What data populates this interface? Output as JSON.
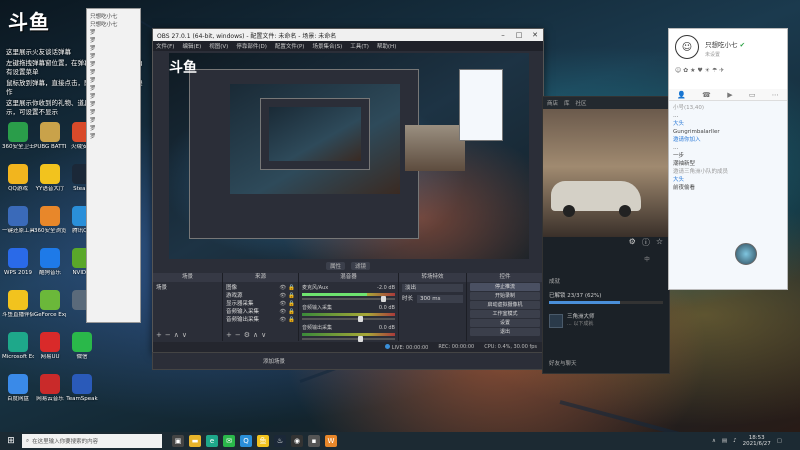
{
  "colors": {
    "accent": "#3a8fd9",
    "obs_bg": "#2b2e38",
    "taskbar": "#1c2a33",
    "qq_verified": "#2ba245"
  },
  "overlay": {
    "logo_text": "斗鱼",
    "chat": [
      {
        "text": "这里展示火友谈话弹幕"
      },
      {
        "text": "左键拖拽弹幕窗位置，在弹幕区域内鼠标右上角有设置菜单"
      },
      {
        "text": "鼠标放到弹幕，直接点击，即可进行弹幕收缩操作"
      },
      {
        "text": "这里展示你收到的礼物、道具、贵族开通的提示，可设置不显示"
      }
    ]
  },
  "desktop_icons": [
    {
      "label": "360安全卫士",
      "icon": "shield-icon",
      "color": "#2a9d4a"
    },
    {
      "label": "PUBG BATTLEGR...",
      "icon": "pubg-icon",
      "color": "#c9a24a"
    },
    {
      "label": "火绒安全",
      "icon": "fire-icon",
      "color": "#d94a2a"
    },
    {
      "label": "QQ游戏",
      "icon": "qq-game-icon",
      "color": "#f2b51e"
    },
    {
      "label": "YY语音大厅",
      "icon": "yy-icon",
      "color": "#f2c31e"
    },
    {
      "label": "Steam",
      "icon": "steam-icon",
      "color": "#1b2838"
    },
    {
      "label": "一键还原工具",
      "icon": "restore-icon",
      "color": "#3a6ab9"
    },
    {
      "label": "360安全浏览器",
      "icon": "browser-icon",
      "color": "#e8872a"
    },
    {
      "label": "腾讯QQ",
      "icon": "qq-icon",
      "color": "#2a8fd9"
    },
    {
      "label": "WPS 2019",
      "icon": "wps-icon",
      "color": "#2a6ae8"
    },
    {
      "label": "酷狗音乐",
      "icon": "kugou-icon",
      "color": "#1e7ae8"
    },
    {
      "label": "NVIDIA",
      "icon": "nvidia-icon",
      "color": "#5aa82a"
    },
    {
      "label": "斗鱼直播伴侣",
      "icon": "douyu-icon",
      "color": "#f2c31e"
    },
    {
      "label": "GeForce Experience",
      "icon": "geforce-icon",
      "color": "#6bb83a"
    },
    {
      "label": "",
      "icon": "app-icon",
      "color": "#5a6a7a"
    },
    {
      "label": "Microsoft Edge",
      "icon": "edge-icon",
      "color": "#1ea88a"
    },
    {
      "label": "网易UU",
      "icon": "uu-icon",
      "color": "#d92a2a"
    },
    {
      "label": "微信",
      "icon": "wechat-icon",
      "color": "#2ab84a"
    },
    {
      "label": "百度网盘",
      "icon": "baidu-icon",
      "color": "#3a8ae8"
    },
    {
      "label": "网易云音乐",
      "icon": "music-icon",
      "color": "#c92a2a"
    },
    {
      "label": "TeamSpeak",
      "icon": "teamspeak-icon",
      "color": "#2a5ab9"
    }
  ],
  "left_chat": {
    "lines": [
      "只想吃小七",
      "只想吃小七",
      "罗",
      "罗",
      "罗",
      "罗",
      "罗",
      "罗",
      "罗",
      "罗",
      "罗",
      "罗",
      "罗",
      "罗",
      "罗",
      "罗"
    ]
  },
  "obs": {
    "title": "OBS 27.0.1 (64-bit, windows) - 配置文件: 未命名 - 场景: 未命名",
    "menu": [
      "文件(F)",
      "编辑(E)",
      "视图(V)",
      "停靠部件(D)",
      "配置文件(P)",
      "场景集合(S)",
      "工具(T)",
      "帮助(H)"
    ],
    "toolbar": [
      "属性",
      "滤镜"
    ],
    "docks": {
      "scenes": {
        "header": "场景",
        "items": [
          "场景"
        ]
      },
      "sources": {
        "header": "来源",
        "items": [
          "图像",
          "游戏源",
          "显示器采集",
          "音频输入采集",
          "音频输出采集"
        ]
      },
      "mixer": {
        "header": "混音器",
        "rows": [
          {
            "name": "麦克风/Aux",
            "db": "-2.0 dB",
            "level": 0.7,
            "volume": 0.85
          },
          {
            "name": "音频输入采集",
            "db": "0.0 dB",
            "level": 0.0,
            "volume": 0.6
          },
          {
            "name": "音频输出采集",
            "db": "0.0 dB",
            "level": 0.0,
            "volume": 0.6
          }
        ]
      },
      "transitions": {
        "header": "转场特效",
        "label": "淡出",
        "duration_label": "时长",
        "duration": "300 ms"
      },
      "controls": {
        "header": "控件",
        "buttons": [
          "停止推流",
          "开始录制",
          "启动虚拟摄像机",
          "工作室模式",
          "设置",
          "退出"
        ]
      }
    },
    "status": {
      "live": "LIVE: 00:00:00",
      "rec": "REC: 00:00:00",
      "cpu": "CPU: 0.4%, 30.00 fps"
    },
    "below_label": "添加场景"
  },
  "launcher": {
    "top": [
      "商店",
      "库",
      "社区"
    ],
    "tabs": [
      "",
      "",
      "中"
    ],
    "ach_header": "成就",
    "ach_progress_text": "已解锁 23/37 (62%)",
    "ach_progress": 0.62,
    "ach_item_title": "三角洲大师",
    "ach_item_sub": "... 以下成就",
    "bottom": [
      "好友与聊天",
      ""
    ]
  },
  "qq": {
    "name": "只想吃小七",
    "signature": "未设置",
    "toolbar": [
      "person-icon",
      "phone-icon",
      "video-icon",
      "screen-icon",
      "more-icon"
    ],
    "messages": [
      {
        "text": "小号(13,40)",
        "cls": "gray"
      },
      {
        "text": "…",
        "cls": ""
      },
      {
        "text": "大头",
        "cls": "blue"
      },
      {
        "text": "Gungrimbalarller",
        "cls": ""
      },
      {
        "text": "邀请你加入",
        "cls": "blue"
      },
      {
        "text": "…",
        "cls": ""
      },
      {
        "text": "一步",
        "cls": ""
      },
      {
        "text": "潮袖新型",
        "cls": ""
      },
      {
        "text": "邀请三角洲小队的成员",
        "cls": "gray"
      },
      {
        "text": "大头",
        "cls": "blue"
      },
      {
        "text": "前夜偷看",
        "cls": ""
      }
    ]
  },
  "taskbar": {
    "search_placeholder": "在这里输入你要搜索的内容",
    "time": "18:53",
    "date": "2021/6/27",
    "apps": [
      {
        "icon": "task-view-icon",
        "color": "#444"
      },
      {
        "icon": "explorer-icon",
        "color": "#e8b42a"
      },
      {
        "icon": "edge-icon",
        "color": "#1ea88a"
      },
      {
        "icon": "wechat-icon",
        "color": "#2ab84a"
      },
      {
        "icon": "qq-icon",
        "color": "#2a8fd9"
      },
      {
        "icon": "douyu-icon",
        "color": "#f2c31e"
      },
      {
        "icon": "steam-icon",
        "color": "#1b2838"
      },
      {
        "icon": "obs-icon",
        "color": "#333"
      },
      {
        "icon": "app-icon",
        "color": "#555"
      },
      {
        "icon": "wps-icon",
        "color": "#e8872a"
      }
    ]
  }
}
